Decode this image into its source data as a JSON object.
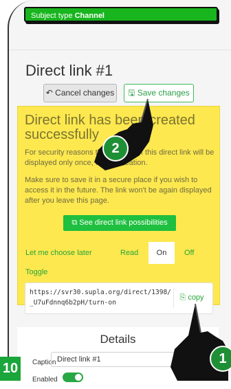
{
  "subject_bar": {
    "prefix": "Subject type ",
    "value": "Channel"
  },
  "page": {
    "title": "Direct link #1"
  },
  "toolbar": {
    "cancel_label": "Cancel changes",
    "save_label": "Save changes"
  },
  "alert": {
    "title": "Direct link has been created successfully",
    "p1": "For security reasons the full URL of this direct link will be displayed only once, during creation.",
    "p2": "Make sure to save it in a secure place if you wish to access it in the future. The link won't be again displayed after you leave this page.",
    "possibilities_label": "See direct link possibilities",
    "actions": {
      "later": "Let me choose later",
      "read": "Read",
      "on": "On",
      "off": "Off",
      "toggle": "Toggle"
    },
    "url": "https://svr30.supla.org/direct/1398/_U7uFdnnq6b2pH/turn-on",
    "copy_label": "copy"
  },
  "details": {
    "heading": "Details",
    "caption_label": "Caption",
    "caption_value": "Direct link #1",
    "enabled_label": "Enabled"
  },
  "overlay": {
    "step_badge": "10",
    "marker_1": "1",
    "marker_2": "2"
  },
  "colors": {
    "green": "#18b51e",
    "alert_yellow": "#fde84f",
    "link_green": "#27a539"
  },
  "icons": {
    "cancel": "undo-icon",
    "save": "floppy-disk-icon",
    "possibilities": "external-link-icon",
    "copy": "clipboard-icon"
  }
}
